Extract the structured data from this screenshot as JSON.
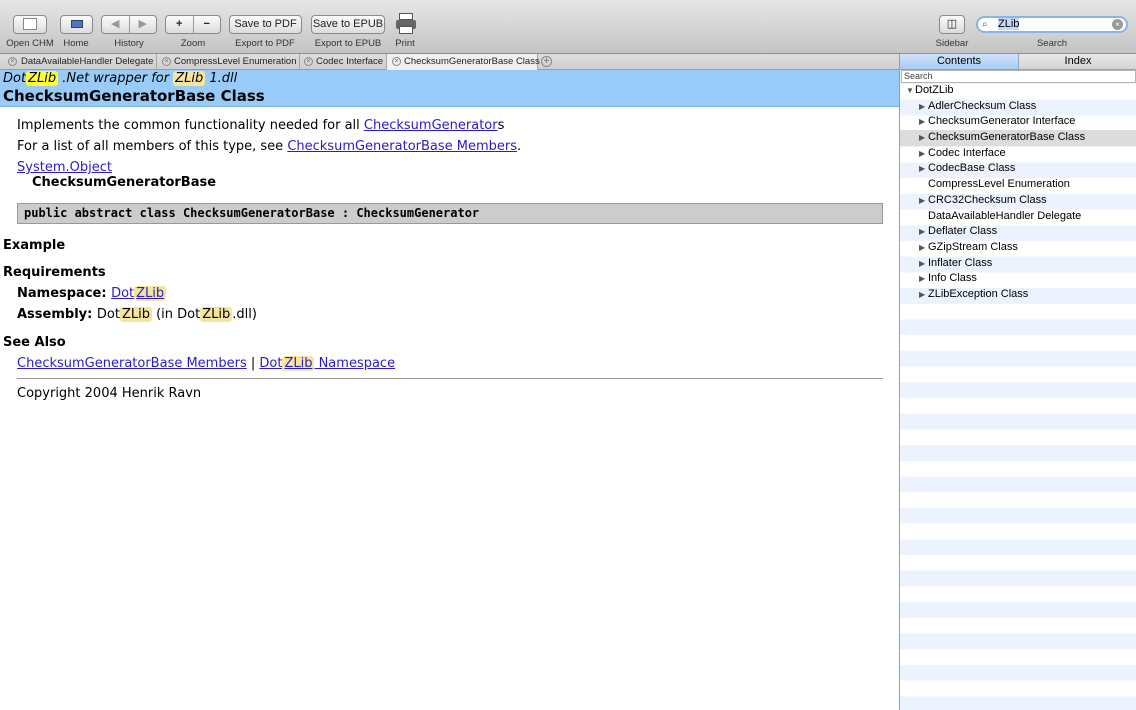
{
  "toolbar": {
    "open_chm": "Open CHM",
    "home": "Home",
    "history": "History",
    "zoom": "Zoom",
    "zoom_in": "+",
    "zoom_out": "−",
    "save_pdf": "Save to PDF",
    "export_pdf": "Export to PDF",
    "save_epub": "Save to EPUB",
    "export_epub": "Export to EPUB",
    "print": "Print",
    "sidebar": "Sidebar",
    "search": "Search",
    "search_value": "ZLib"
  },
  "tabs": [
    {
      "label": "DataAvailableHandler Delegate",
      "close": "×"
    },
    {
      "label": "CompressLevel Enumeration",
      "close": "×"
    },
    {
      "label": "Codec Interface",
      "close": "×"
    },
    {
      "label": "ChecksumGeneratorBase Class",
      "close": "×"
    }
  ],
  "tab_add": "+",
  "page": {
    "subtitle_pre": "Dot",
    "subtitle_zlib": "ZLib",
    "subtitle_mid": " .Net wrapper for ",
    "subtitle_zlib2": "ZLib",
    "subtitle_post": " 1.dll",
    "title": "ChecksumGeneratorBase Class",
    "intro_text": "Implements the common functionality needed for all ",
    "intro_link": "ChecksumGenerator",
    "intro_suffix": "s",
    "members_text": "For a list of all members of this type, see ",
    "members_link": "ChecksumGeneratorBase Members",
    "members_suffix": ".",
    "system_object": "System.Object",
    "class_name": "ChecksumGeneratorBase",
    "declaration": "public abstract class ChecksumGeneratorBase : ChecksumGenerator",
    "example_heading": "Example",
    "requirements_heading": "Requirements",
    "namespace_label": "Namespace: ",
    "namespace_dot": "Dot",
    "namespace_zlib": "ZLib",
    "assembly_label": "Assembly: ",
    "assembly_dot": "Dot",
    "assembly_zlib": "ZLib",
    "assembly_in": " (in Dot",
    "assembly_zlib2": "ZLib",
    "assembly_dll": ".dll)",
    "see_also_heading": "See Also",
    "see_also_members": "ChecksumGeneratorBase Members",
    "see_also_sep": " | ",
    "see_also_dot": "Dot",
    "see_also_zlib": "ZLib",
    "see_also_ns": " Namespace",
    "copyright": "Copyright 2004 Henrik Ravn"
  },
  "sidebar": {
    "tab_contents": "Contents",
    "tab_index": "Index",
    "search_label": "Search",
    "root": "DotZLib",
    "items": [
      {
        "label": "AdlerChecksum Class",
        "expandable": true
      },
      {
        "label": "ChecksumGenerator Interface",
        "expandable": true
      },
      {
        "label": "ChecksumGeneratorBase Class",
        "expandable": true
      },
      {
        "label": "Codec Interface",
        "expandable": true
      },
      {
        "label": "CodecBase Class",
        "expandable": true
      },
      {
        "label": "CompressLevel Enumeration",
        "expandable": false
      },
      {
        "label": "CRC32Checksum Class",
        "expandable": true
      },
      {
        "label": "DataAvailableHandler Delegate",
        "expandable": false
      },
      {
        "label": "Deflater Class",
        "expandable": true
      },
      {
        "label": "GZipStream Class",
        "expandable": true
      },
      {
        "label": "Inflater Class",
        "expandable": true
      },
      {
        "label": "Info Class",
        "expandable": true
      },
      {
        "label": "ZLibException Class",
        "expandable": true
      }
    ]
  },
  "icons": {
    "tri_right": "▶",
    "tri_down": "▼",
    "back": "◀",
    "forward": "▶",
    "home_icon": "▭",
    "sidebar_icon": "◫",
    "search_glass": "⌕",
    "clear": "×"
  }
}
